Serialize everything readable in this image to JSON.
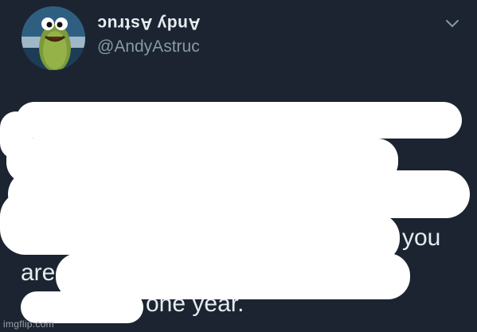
{
  "profile": {
    "display_name": "Andy Astruc",
    "handle": "@AndyAstruc",
    "avatar_icon": "cartoon-character-avatar"
  },
  "tweet": {
    "fragments": [
      "you",
      "are",
      "one year."
    ]
  },
  "menu_icon": "chevron-down-icon",
  "watermark": "imgflip.com",
  "colors": {
    "background": "#1b2430",
    "text": "#e6ecf0",
    "secondary_text": "#8899a6",
    "redaction": "#ffffff"
  }
}
